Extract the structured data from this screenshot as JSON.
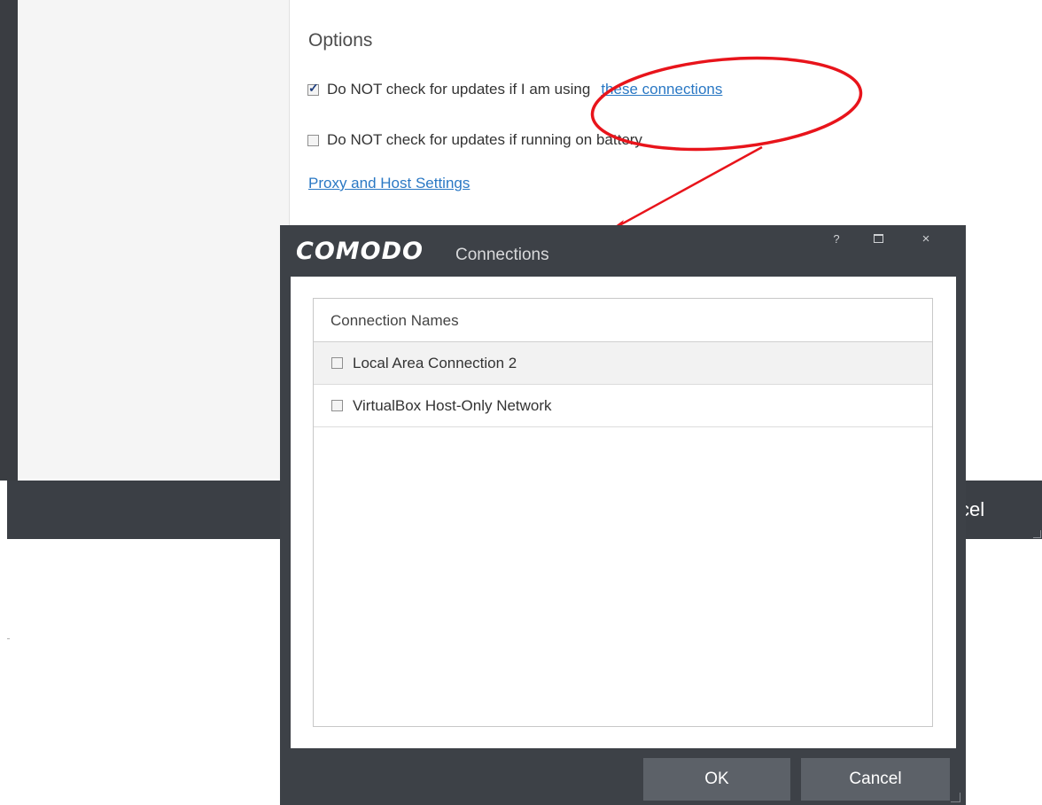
{
  "background_window": {
    "options_heading": "Options",
    "option_1": {
      "label": "Do NOT check for updates if I am using",
      "link": "these connections",
      "checked": true
    },
    "option_2": {
      "label": "Do NOT check for updates if running on battery",
      "checked": false
    },
    "proxy_link": "Proxy and Host Settings",
    "cancel_fragment": "cel"
  },
  "annotation": {
    "color": "#e8141b",
    "shape": "ellipse-with-arrow"
  },
  "dialog": {
    "logo": "COMODO",
    "title": "Connections",
    "title_buttons": {
      "help": "?",
      "maximize_icon": "maximize-icon",
      "close": "×"
    },
    "list_header": "Connection Names",
    "connections": [
      {
        "name": "Local Area Connection 2",
        "checked": false
      },
      {
        "name": "VirtualBox Host-Only Network",
        "checked": false
      }
    ],
    "ok_label": "OK",
    "cancel_label": "Cancel"
  },
  "colors": {
    "frame_dark": "#3d4147",
    "button": "#5c6168",
    "link": "#2a78c4",
    "annotation_red": "#e8141b"
  }
}
